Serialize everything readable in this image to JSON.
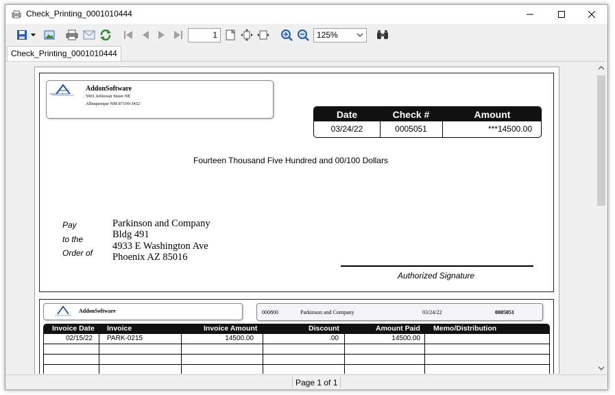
{
  "window": {
    "title": "Check_Printing_0001010444"
  },
  "toolbar": {
    "page_number": "1",
    "zoom_value": "125%"
  },
  "tabs": [
    {
      "label": "Check_Printing_0001010444"
    }
  ],
  "status": {
    "page_text": "Page 1 of 1"
  },
  "check": {
    "company_name": "AddonSoftware",
    "company_address1": "5901 Jefferson Street NE",
    "company_address2": "Albuquerque NM  87109-3432",
    "logo_text": "AddonSoftware",
    "headers": {
      "date": "Date",
      "check_no": "Check #",
      "amount": "Amount"
    },
    "date": "03/24/22",
    "check_no": "0005051",
    "amount": "***14500.00",
    "amount_words": "Fourteen Thousand Five Hundred and 00/100 Dollars",
    "pay_label_1": "Pay",
    "pay_label_2": "to the",
    "pay_label_3": "Order of",
    "payee_line1": "Parkinson and Company",
    "payee_line2": "Bldg 491",
    "payee_line3": "4933 E Washington Ave",
    "payee_line4": "Phoenix AZ  85016",
    "signature_label": "Authorized Signature"
  },
  "stub": {
    "company_name": "AddonSoftware",
    "vendor_id": "000800",
    "vendor_name": "Parkinson and Company",
    "date": "03/24/22",
    "check_no": "0005051",
    "columns": [
      "Invoice Date",
      "Invoice",
      "Invoice Amount",
      "Discount",
      "Amount Paid",
      "Memo/Distribution"
    ],
    "rows": [
      {
        "invoice_date": "02/15/22",
        "invoice": "PARK-0215",
        "invoice_amount": "14500.00",
        "discount": ".00",
        "amount_paid": "14500.00",
        "memo": ""
      }
    ]
  },
  "colors": {
    "header_bg": "#111111",
    "accent_blue": "#1f4e9c"
  }
}
